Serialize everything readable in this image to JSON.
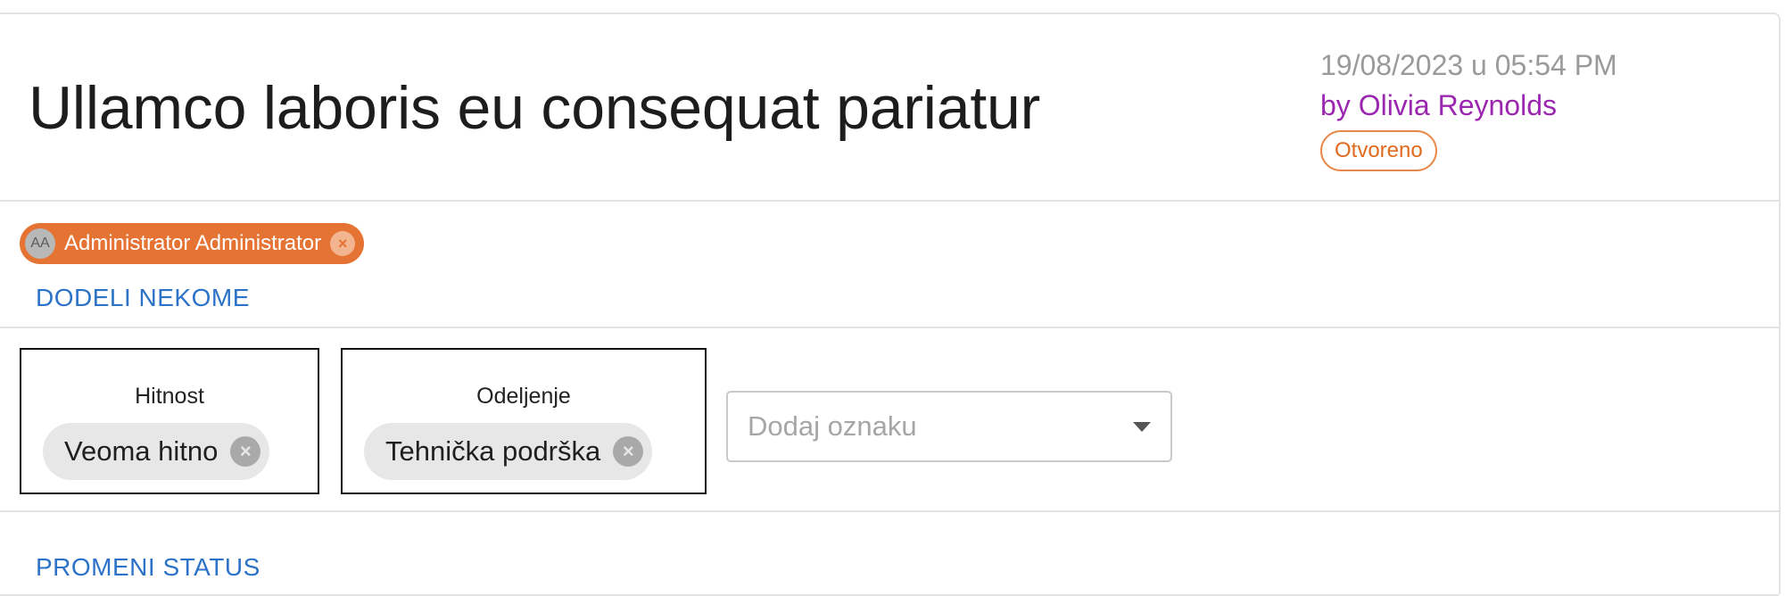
{
  "ticket": {
    "title": "Ullamco laboris eu consequat pariatur",
    "timestamp": "19/08/2023 u 05:54 PM",
    "author": "by Olivia Reynolds",
    "status": "Otvoreno"
  },
  "assignment": {
    "assignee": {
      "initials": "AA",
      "name": "Administrator Administrator",
      "remove_icon": "x-circle-icon"
    },
    "assign_link": "DODELI NEKOME"
  },
  "tags": {
    "urgency": {
      "label": "Hitnost",
      "value": "Veoma hitno"
    },
    "department": {
      "label": "Odeljenje",
      "value": "Tehnička podrška"
    },
    "add_tag": {
      "placeholder": "Dodaj oznaku",
      "icon": "chevron-down-icon"
    }
  },
  "status_action": {
    "label": "PROMENI STATUS"
  },
  "colors": {
    "accent_link": "#2b72c8",
    "author": "#9b27b0",
    "status": "#e06a1f",
    "assignee_chip": "#e57333"
  }
}
